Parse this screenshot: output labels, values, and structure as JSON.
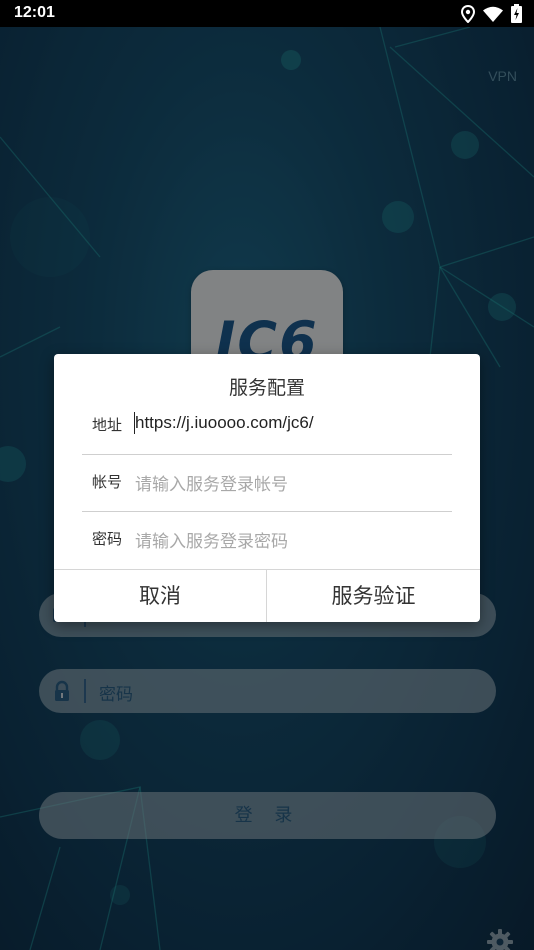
{
  "status_bar": {
    "time": "12:01",
    "icons": [
      "location-icon",
      "wifi-icon",
      "battery-charging-icon"
    ]
  },
  "login_screen": {
    "vpn_label": "VPN",
    "logo_text": "JC6",
    "username_placeholder": "",
    "password_placeholder": "密码",
    "login_button": "登 录"
  },
  "dialog": {
    "title": "服务配置",
    "address_label": "地址",
    "address_value": "https://j.iuoooo.com/jc6/",
    "account_label": "帐号",
    "account_placeholder": "请输入服务登录帐号",
    "password_label": "密码",
    "password_placeholder": "请输入服务登录密码",
    "cancel_button": "取消",
    "verify_button": "服务验证"
  },
  "colors": {
    "background": "#17506f",
    "dialog": "#ffffff",
    "logo_blue": "#1d5a8e",
    "field_text": "#2b5f85"
  }
}
